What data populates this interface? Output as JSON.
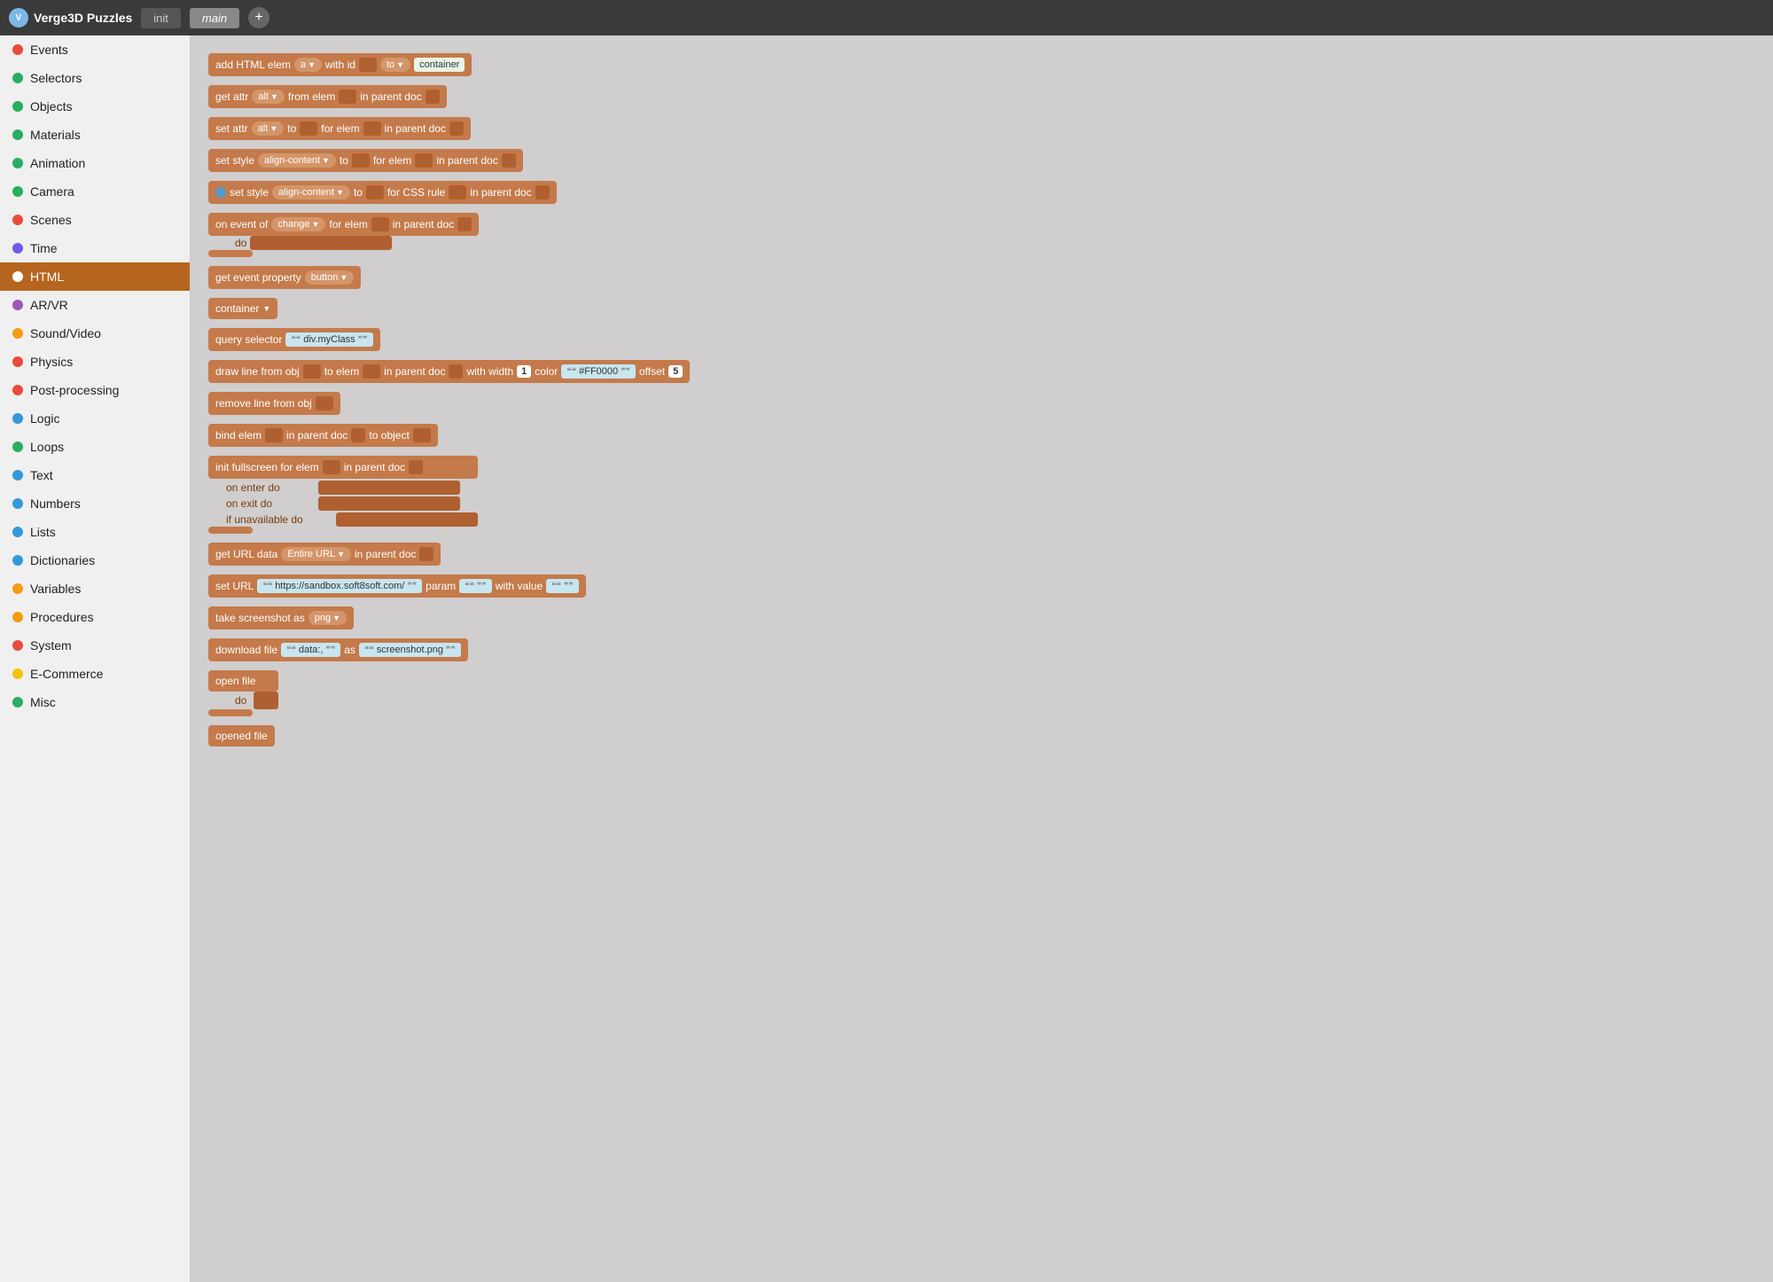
{
  "header": {
    "logo_text": "Verge3D Puzzles",
    "tab1": "init",
    "tab2": "main",
    "add_tab_label": "+"
  },
  "sidebar": {
    "items": [
      {
        "label": "Events",
        "color": "#e74c3c",
        "active": false
      },
      {
        "label": "Selectors",
        "color": "#27ae60",
        "active": false
      },
      {
        "label": "Objects",
        "color": "#27ae60",
        "active": false
      },
      {
        "label": "Materials",
        "color": "#27ae60",
        "active": false
      },
      {
        "label": "Animation",
        "color": "#27ae60",
        "active": false
      },
      {
        "label": "Camera",
        "color": "#27ae60",
        "active": false
      },
      {
        "label": "Scenes",
        "color": "#e74c3c",
        "active": false
      },
      {
        "label": "Time",
        "color": "#6c5ce7",
        "active": false
      },
      {
        "label": "HTML",
        "color": "#b5651d",
        "active": true
      },
      {
        "label": "AR/VR",
        "color": "#9b59b6",
        "active": false
      },
      {
        "label": "Sound/Video",
        "color": "#f39c12",
        "active": false
      },
      {
        "label": "Physics",
        "color": "#e74c3c",
        "active": false
      },
      {
        "label": "Post-processing",
        "color": "#e74c3c",
        "active": false
      },
      {
        "label": "Logic",
        "color": "#3498db",
        "active": false
      },
      {
        "label": "Loops",
        "color": "#27ae60",
        "active": false
      },
      {
        "label": "Text",
        "color": "#3498db",
        "active": false
      },
      {
        "label": "Numbers",
        "color": "#3498db",
        "active": false
      },
      {
        "label": "Lists",
        "color": "#3498db",
        "active": false
      },
      {
        "label": "Dictionaries",
        "color": "#3498db",
        "active": false
      },
      {
        "label": "Variables",
        "color": "#f39c12",
        "active": false
      },
      {
        "label": "Procedures",
        "color": "#f39c12",
        "active": false
      },
      {
        "label": "System",
        "color": "#e74c3c",
        "active": false
      },
      {
        "label": "E-Commerce",
        "color": "#f1c40f",
        "active": false
      },
      {
        "label": "Misc",
        "color": "#27ae60",
        "active": false
      }
    ]
  },
  "blocks": {
    "b1": "add HTML elem",
    "b1_pill1": "a",
    "b1_text1": "with id",
    "b1_pill2": "to",
    "b1_val": "container",
    "b2": "get attr",
    "b2_pill": "alt",
    "b2_text": "from elem",
    "b2_text2": "in parent doc",
    "b3": "set attr",
    "b3_pill": "alt",
    "b3_text": "to",
    "b3_text2": "for elem",
    "b3_text3": "in parent doc",
    "b4": "set style",
    "b4_pill": "align-content",
    "b4_text": "to",
    "b4_text2": "for elem",
    "b4_text3": "in parent doc",
    "b5": "set style",
    "b5_pill": "align-content",
    "b5_text": "to",
    "b5_text2": "for CSS rule",
    "b5_text3": "in parent doc",
    "b6": "on event of",
    "b6_pill": "change",
    "b6_text": "for elem",
    "b6_text2": "in parent doc",
    "b6_do": "do",
    "b7": "get event property",
    "b7_pill": "button",
    "b8_val": "container",
    "b9": "query selector",
    "b9_val": "div.myClass",
    "b10": "draw line from obj",
    "b10_text1": "to elem",
    "b10_text2": "in parent doc",
    "b10_text3": "with width",
    "b10_num": "1",
    "b10_text4": "color",
    "b10_color": "#FF0000",
    "b10_text5": "offset",
    "b10_offset": "5",
    "b11": "remove line from obj",
    "b12": "bind elem",
    "b12_text1": "in parent doc",
    "b12_text2": "to object",
    "b13": "init fullscreen for elem",
    "b13_text": "in parent doc",
    "b13_enter": "on enter do",
    "b13_exit": "on exit do",
    "b13_unavail": "if unavailable do",
    "b14": "get URL data",
    "b14_pill": "Entire URL",
    "b14_text": "in parent doc",
    "b15": "set URL",
    "b15_val": "https://sandbox.soft8soft.com/",
    "b15_text1": "param",
    "b15_text2": "with value",
    "b16": "take screenshot as",
    "b16_pill": "png",
    "b17": "download file",
    "b17_val1": "data:,",
    "b17_text": "as",
    "b17_val2": "screenshot.png",
    "b18": "open file",
    "b18_do": "do",
    "b19": "opened file"
  }
}
